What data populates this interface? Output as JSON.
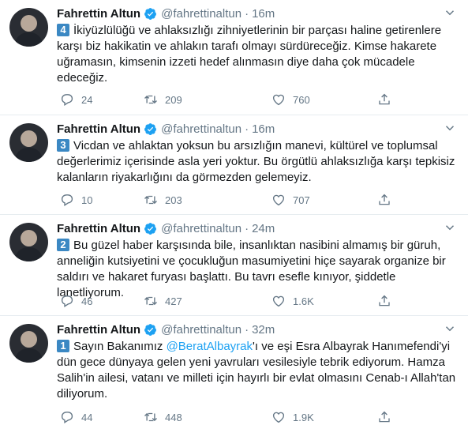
{
  "tweets": [
    {
      "name": "Fahrettin Altun",
      "handle": "@fahrettinaltun",
      "separator": "·",
      "time": "16m",
      "number": "4",
      "text_parts": [
        "İkiyüzlülüğü ve ahlaksızlığı zihniyetlerinin bir parçası haline getirenlere karşı biz hakikatin ve ahlakın tarafı olmayı sürdüreceğiz. Kimse hakarete uğramasın, kimsenin izzeti hedef alınmasın diye daha çok mücadele edeceğiz."
      ],
      "replies": "24",
      "retweets": "209",
      "likes": "760"
    },
    {
      "name": "Fahrettin Altun",
      "handle": "@fahrettinaltun",
      "separator": "·",
      "time": "16m",
      "number": "3",
      "text_parts": [
        "Vicdan ve ahlaktan yoksun bu arsızlığın manevi, kültürel ve toplumsal değerlerimiz içerisinde asla yeri yoktur. Bu örgütlü ahlaksızlığa karşı tepkisiz kalanların riyakarlığını da görmezden gelemeyiz."
      ],
      "replies": "10",
      "retweets": "203",
      "likes": "707"
    },
    {
      "name": "Fahrettin Altun",
      "handle": "@fahrettinaltun",
      "separator": "·",
      "time": "24m",
      "number": "2",
      "text_parts": [
        "Bu güzel haber karşısında bile, insanlıktan nasibini almamış bir güruh, anneliğin kutsiyetini ve çocukluğun masumiyetini hiçe sayarak organize bir saldırı ve hakaret furyası başlattı. Bu tavrı esefle kınıyor, şiddetle lanetliyorum."
      ],
      "replies": "46",
      "retweets": "427",
      "likes": "1.6K"
    },
    {
      "name": "Fahrettin Altun",
      "handle": "@fahrettinaltun",
      "separator": "·",
      "time": "32m",
      "number": "1",
      "text_before": "Sayın Bakanımız ",
      "mention": "@BeratAlbayrak",
      "text_after": "'ı ve eşi Esra Albayrak Hanımefendi'yi dün gece dünyaya gelen yeni yavruları vesilesiyle tebrik ediyorum. Hamza Salih'in ailesi, vatanı ve milleti için hayırlı bir evlat olmasını Cenab-ı Allah'tan diliyorum.",
      "replies": "44",
      "retweets": "448",
      "likes": "1.9K"
    }
  ],
  "colors": {
    "accent": "#1da1f2",
    "number_badge": "#3b88c3",
    "muted": "#657786",
    "divider": "#e6ecf0"
  },
  "icons": [
    "verified-badge-icon",
    "caret-down-icon",
    "reply-icon",
    "retweet-icon",
    "like-icon",
    "share-icon"
  ]
}
